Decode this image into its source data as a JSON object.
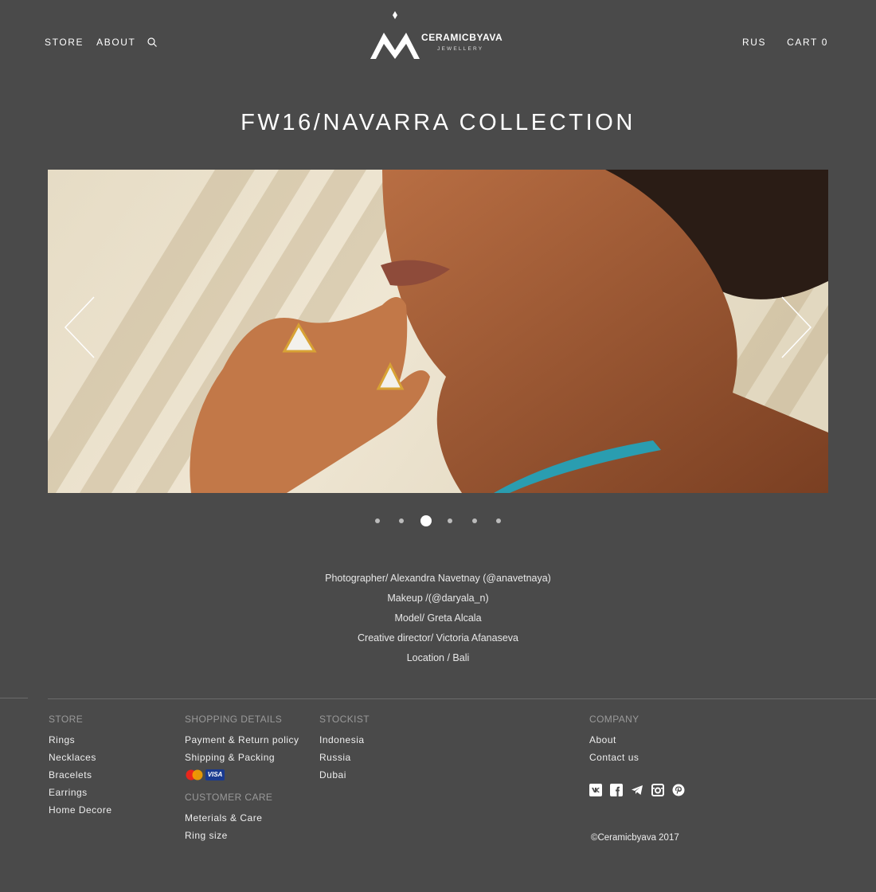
{
  "header": {
    "nav_left": [
      "STORE",
      "ABOUT"
    ],
    "logo_main": "CERAMICBYAVA",
    "logo_sub": "JEWELLERY",
    "lang": "RUS",
    "cart_label": "CART",
    "cart_count": "0"
  },
  "page_title": "FW16/NAVARRA COLLECTION",
  "slider": {
    "slide_count": 6,
    "active_index": 2
  },
  "credits": [
    "Photographer/ Alexandra Navetnay (@anavetnaya)",
    "Makeup /(@daryala_n)",
    "Model/ Greta Alcala",
    "Creative director/ Victoria Afanaseva",
    "Location / Bali"
  ],
  "footer": {
    "store": {
      "heading": "STORE",
      "links": [
        "Rings",
        "Necklaces",
        "Bracelets",
        "Earrings",
        "Home Decore"
      ]
    },
    "shopping": {
      "heading": "SHOPPING DETAILS",
      "links": [
        "Payment & Return policy",
        "Shipping & Packing"
      ],
      "visa_label": "VISA"
    },
    "care": {
      "heading": "CUSTOMER CARE",
      "links": [
        "Meterials & Care",
        "Ring size"
      ]
    },
    "stockist": {
      "heading": "STOCKIST",
      "links": [
        "Indonesia",
        "Russia",
        "Dubai"
      ]
    },
    "company": {
      "heading": "COMPANY",
      "links": [
        "About",
        "Contact us"
      ]
    },
    "social_icons": [
      "vk-icon",
      "facebook-icon",
      "telegram-icon",
      "instagram-icon",
      "pinterest-icon"
    ],
    "copyright": "©Ceramicbyava 2017"
  },
  "colors": {
    "background": "#4a4a4a",
    "text": "#ffffff",
    "footer_heading": "#9a9a9a",
    "divider": "#6a6a6a"
  }
}
